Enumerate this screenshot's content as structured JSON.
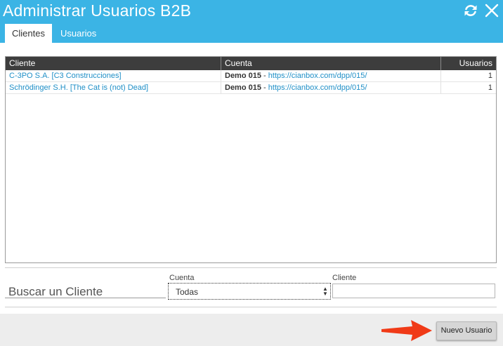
{
  "window": {
    "title": "Administrar Usuarios B2B",
    "refresh_icon": "refresh-icon",
    "close_icon": "close-icon"
  },
  "tabs": [
    {
      "label": "Clientes",
      "active": true
    },
    {
      "label": "Usuarios",
      "active": false
    }
  ],
  "grid": {
    "columns": {
      "cliente": "Cliente",
      "cuenta": "Cuenta",
      "usuarios": "Usuarios"
    },
    "rows": [
      {
        "cliente": "C-3PO S.A. [C3 Construcciones]",
        "cuenta_name": "Demo 015",
        "cuenta_sep": " - ",
        "cuenta_url": "https://cianbox.com/dpp/015/",
        "usuarios": "1"
      },
      {
        "cliente": "Schrödinger S.H. [The Cat is (not) Dead]",
        "cuenta_name": "Demo 015",
        "cuenta_sep": " - ",
        "cuenta_url": "https://cianbox.com/dpp/015/",
        "usuarios": "1"
      }
    ]
  },
  "search": {
    "label": "Buscar un Cliente",
    "cuenta_label": "Cuenta",
    "cuenta_selected": "Todas",
    "cliente_label": "Cliente",
    "cliente_value": ""
  },
  "footer": {
    "new_user_button": "Nuevo Usuario",
    "arrow_color": "#f03a17"
  },
  "colors": {
    "header_bar": "#3bb4e5",
    "link": "#1f8fc7",
    "grid_header": "#3d3d3d"
  }
}
